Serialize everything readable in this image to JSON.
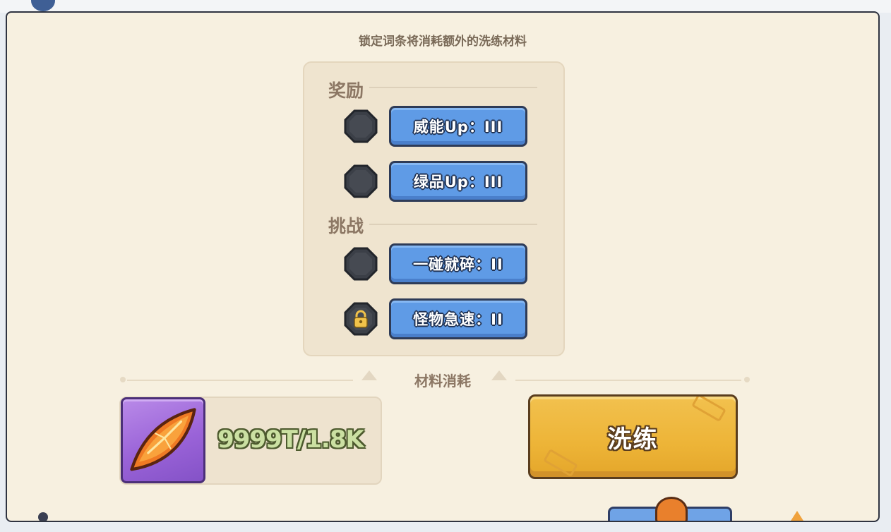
{
  "panel": {
    "hint_text": "锁定词条将消耗额外的洗练材料"
  },
  "sections": [
    {
      "title": "奖励",
      "affixes": [
        {
          "label": "威能Up：III",
          "locked": false
        },
        {
          "label": "绿品Up：III",
          "locked": false
        }
      ]
    },
    {
      "title": "挑战",
      "affixes": [
        {
          "label": "一碰就碎：II",
          "locked": false
        },
        {
          "label": "怪物急速：II",
          "locked": true
        }
      ]
    }
  ],
  "material": {
    "divider_title": "材料消耗",
    "icon": "orange-crystal-icon",
    "count": "9999T/1.8K"
  },
  "actions": {
    "refine_label": "洗练"
  },
  "colors": {
    "panel_bg": "#f7f0e0",
    "affix_blue": "#5f9be6",
    "refine_gold": "#edb437",
    "material_purple": "#9a63d8",
    "count_green": "#cbe0a2"
  }
}
